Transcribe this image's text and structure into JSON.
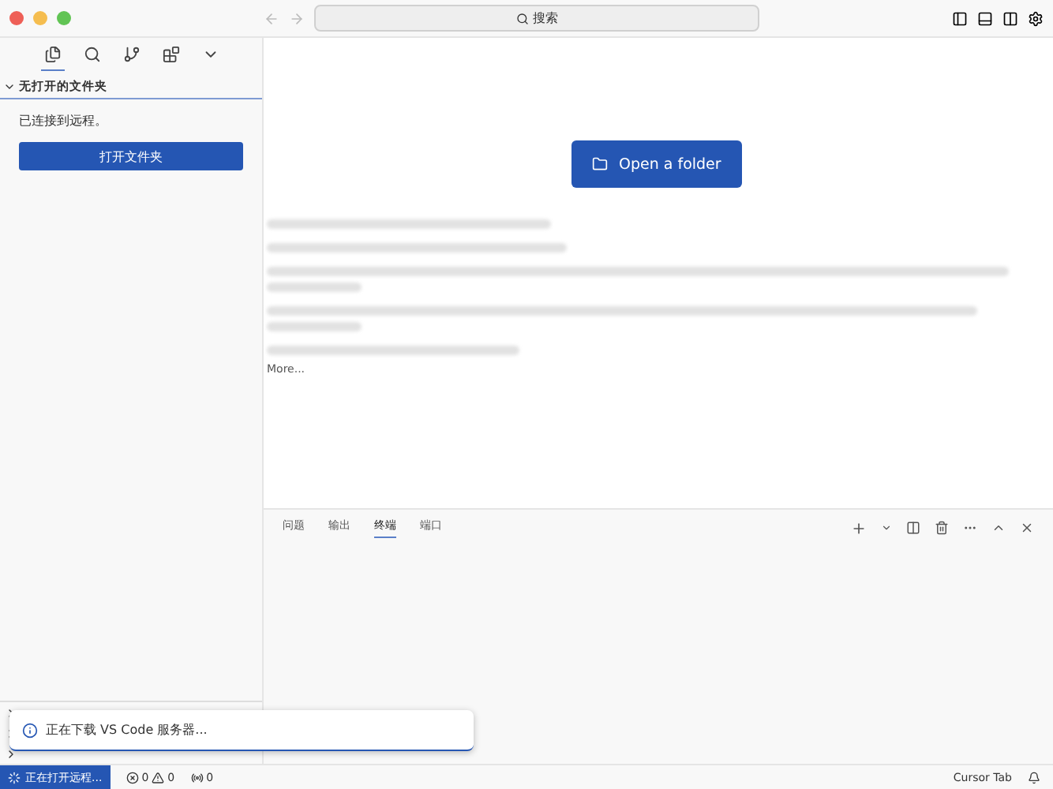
{
  "titlebar": {
    "search_placeholder": "搜索"
  },
  "activity_bar": {
    "items": [
      {
        "kind": "files",
        "selected": true
      },
      {
        "kind": "search",
        "selected": false
      },
      {
        "kind": "branch",
        "selected": false
      },
      {
        "kind": "extensions",
        "selected": false
      },
      {
        "kind": "more",
        "selected": false
      }
    ]
  },
  "sidebar": {
    "section_title": "无打开的文件夹",
    "message": "已连接到远程。",
    "button": "打开文件夹",
    "sections": [
      {
        "expanded": false
      },
      {
        "expanded": false
      },
      {
        "expanded": false
      }
    ]
  },
  "editor": {
    "open_folder_button": "Open a folder",
    "recent": [
      {
        "kind": "blurred_short"
      },
      {
        "kind": "blurred_short"
      },
      {
        "kind": "blurred_long"
      },
      {
        "kind": "blurred_long"
      },
      {
        "kind": "blurred_short"
      }
    ],
    "more": "More..."
  },
  "panel": {
    "tabs": [
      {
        "label": "问题",
        "selected": false
      },
      {
        "label": "输出",
        "selected": false
      },
      {
        "label": "终端",
        "selected": true
      },
      {
        "label": "端口",
        "selected": false
      }
    ]
  },
  "notification": {
    "text": "正在下载 VS Code 服务器..."
  },
  "status_bar": {
    "remote": "正在打开远程...",
    "errors": "0",
    "warnings": "0",
    "ports": "0",
    "right": "Cursor Tab"
  }
}
